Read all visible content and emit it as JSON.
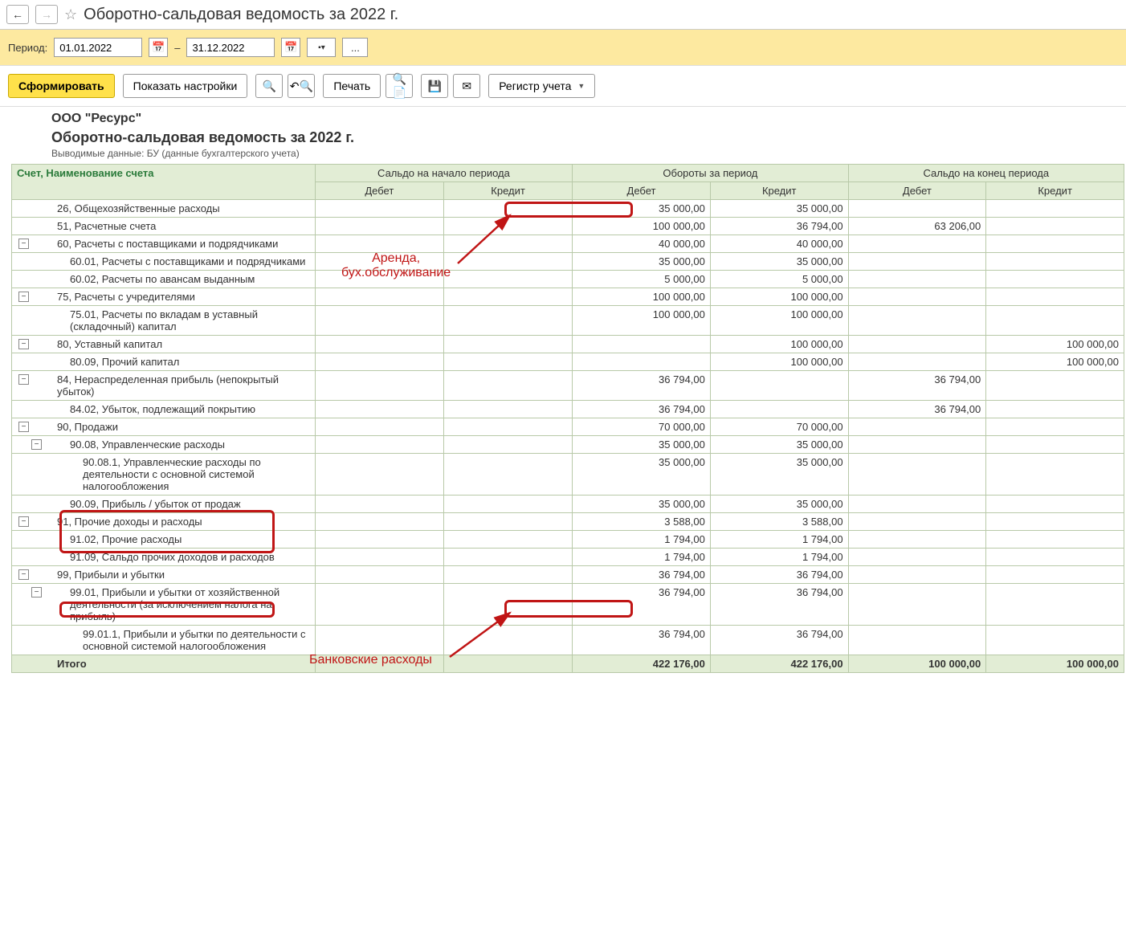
{
  "title": "Оборотно-сальдовая ведомость за 2022 г.",
  "nav": {
    "back": "←",
    "forward": "→",
    "star": "☆"
  },
  "period": {
    "label": "Период:",
    "from": "01.01.2022",
    "dash": "–",
    "to": "31.12.2022",
    "ellipsis": "..."
  },
  "toolbar": {
    "form": "Сформировать",
    "show_settings": "Показать настройки",
    "print": "Печать",
    "register": "Регистр учета"
  },
  "report": {
    "org": "ООО \"Ресурс\"",
    "title": "Оборотно-сальдовая ведомость за 2022 г.",
    "subtitle": "Выводимые данные: БУ (данные бухгалтерского учета)"
  },
  "columns": {
    "account": "Счет, Наименование счета",
    "opening": "Сальдо на начало периода",
    "turnover": "Обороты за период",
    "closing": "Сальдо на конец периода",
    "debit": "Дебет",
    "credit": "Кредит"
  },
  "rows": [
    {
      "lvl": 0,
      "toggle": "",
      "name": "26, Общехозяйственные расходы",
      "od": "",
      "oc": "",
      "td": "35 000,00",
      "tc": "35 000,00",
      "cd": "",
      "cc": ""
    },
    {
      "lvl": 0,
      "toggle": "",
      "name": "51, Расчетные счета",
      "od": "",
      "oc": "",
      "td": "100 000,00",
      "tc": "36 794,00",
      "cd": "63 206,00",
      "cc": ""
    },
    {
      "lvl": 0,
      "toggle": "-",
      "name": "60, Расчеты с поставщиками и подрядчиками",
      "od": "",
      "oc": "",
      "td": "40 000,00",
      "tc": "40 000,00",
      "cd": "",
      "cc": ""
    },
    {
      "lvl": 1,
      "toggle": "",
      "name": "60.01, Расчеты с поставщиками и подрядчиками",
      "od": "",
      "oc": "",
      "td": "35 000,00",
      "tc": "35 000,00",
      "cd": "",
      "cc": ""
    },
    {
      "lvl": 1,
      "toggle": "",
      "name": "60.02, Расчеты по авансам выданным",
      "od": "",
      "oc": "",
      "td": "5 000,00",
      "tc": "5 000,00",
      "cd": "",
      "cc": ""
    },
    {
      "lvl": 0,
      "toggle": "-",
      "name": "75, Расчеты с учредителями",
      "od": "",
      "oc": "",
      "td": "100 000,00",
      "tc": "100 000,00",
      "cd": "",
      "cc": ""
    },
    {
      "lvl": 1,
      "toggle": "",
      "name": "75.01, Расчеты по вкладам в уставный (складочный) капитал",
      "od": "",
      "oc": "",
      "td": "100 000,00",
      "tc": "100 000,00",
      "cd": "",
      "cc": ""
    },
    {
      "lvl": 0,
      "toggle": "-",
      "name": "80, Уставный капитал",
      "od": "",
      "oc": "",
      "td": "",
      "tc": "100 000,00",
      "cd": "",
      "cc": "100 000,00"
    },
    {
      "lvl": 1,
      "toggle": "",
      "name": "80.09, Прочий капитал",
      "od": "",
      "oc": "",
      "td": "",
      "tc": "100 000,00",
      "cd": "",
      "cc": "100 000,00"
    },
    {
      "lvl": 0,
      "toggle": "-",
      "name": "84, Нераспределенная прибыль (непокрытый убыток)",
      "od": "",
      "oc": "",
      "td": "36 794,00",
      "tc": "",
      "cd": "36 794,00",
      "cc": ""
    },
    {
      "lvl": 1,
      "toggle": "",
      "name": "84.02, Убыток, подлежащий покрытию",
      "od": "",
      "oc": "",
      "td": "36 794,00",
      "tc": "",
      "cd": "36 794,00",
      "cc": ""
    },
    {
      "lvl": 0,
      "toggle": "-",
      "name": "90, Продажи",
      "od": "",
      "oc": "",
      "td": "70 000,00",
      "tc": "70 000,00",
      "cd": "",
      "cc": ""
    },
    {
      "lvl": 1,
      "toggle": "-",
      "name": "90.08, Управленческие расходы",
      "od": "",
      "oc": "",
      "td": "35 000,00",
      "tc": "35 000,00",
      "cd": "",
      "cc": ""
    },
    {
      "lvl": 2,
      "toggle": "",
      "name": "90.08.1, Управленческие расходы по деятельности с основной системой налогообложения",
      "od": "",
      "oc": "",
      "td": "35 000,00",
      "tc": "35 000,00",
      "cd": "",
      "cc": ""
    },
    {
      "lvl": 1,
      "toggle": "",
      "name": "90.09, Прибыль / убыток от продаж",
      "od": "",
      "oc": "",
      "td": "35 000,00",
      "tc": "35 000,00",
      "cd": "",
      "cc": ""
    },
    {
      "lvl": 0,
      "toggle": "-",
      "name": "91, Прочие доходы и расходы",
      "od": "",
      "oc": "",
      "td": "3 588,00",
      "tc": "3 588,00",
      "cd": "",
      "cc": ""
    },
    {
      "lvl": 1,
      "toggle": "",
      "name": "91.02, Прочие расходы",
      "od": "",
      "oc": "",
      "td": "1 794,00",
      "tc": "1 794,00",
      "cd": "",
      "cc": ""
    },
    {
      "lvl": 1,
      "toggle": "",
      "name": "91.09, Сальдо прочих доходов и расходов",
      "od": "",
      "oc": "",
      "td": "1 794,00",
      "tc": "1 794,00",
      "cd": "",
      "cc": ""
    },
    {
      "lvl": 0,
      "toggle": "-",
      "name": "99, Прибыли и убытки",
      "od": "",
      "oc": "",
      "td": "36 794,00",
      "tc": "36 794,00",
      "cd": "",
      "cc": ""
    },
    {
      "lvl": 1,
      "toggle": "-",
      "name": "99.01, Прибыли и убытки от хозяйственной деятельности (за исключением налога на прибыль)",
      "od": "",
      "oc": "",
      "td": "36 794,00",
      "tc": "36 794,00",
      "cd": "",
      "cc": ""
    },
    {
      "lvl": 2,
      "toggle": "",
      "name": "99.01.1, Прибыли и убытки по деятельности с основной системой налогообложения",
      "od": "",
      "oc": "",
      "td": "36 794,00",
      "tc": "36 794,00",
      "cd": "",
      "cc": ""
    }
  ],
  "totals": {
    "label": "Итого",
    "od": "",
    "oc": "",
    "td": "422 176,00",
    "tc": "422 176,00",
    "cd": "100 000,00",
    "cc": "100 000,00"
  },
  "annotations": {
    "a1": "Аренда,\nбух.обслуживание",
    "a2": "Банковские расходы"
  }
}
